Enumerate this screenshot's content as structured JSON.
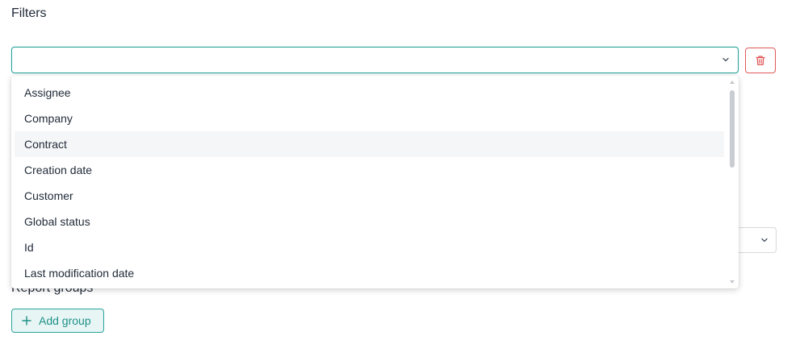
{
  "filters": {
    "title": "Filters",
    "select_value": "",
    "options": [
      "Assignee",
      "Company",
      "Contract",
      "Creation date",
      "Customer",
      "Global status",
      "Id",
      "Last modification date"
    ],
    "hovered_option": "Contract"
  },
  "report_groups": {
    "title": "Report groups",
    "add_label": "Add group"
  },
  "icons": {
    "select": "chevron-down-icon",
    "delete": "trash-icon",
    "add": "plus-icon"
  },
  "colors": {
    "accent": "#2aa39a",
    "danger": "#e25858"
  }
}
